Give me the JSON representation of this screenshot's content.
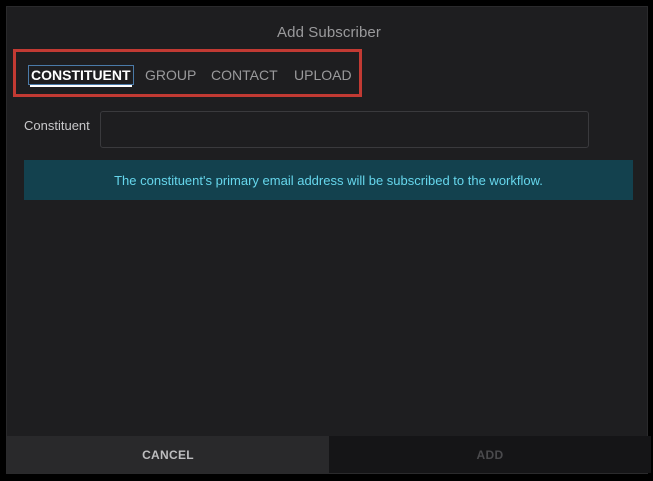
{
  "dialog": {
    "title": "Add Subscriber"
  },
  "tabs": [
    {
      "label": "CONSTITUENT",
      "active": true
    },
    {
      "label": "GROUP",
      "active": false
    },
    {
      "label": "CONTACT",
      "active": false
    },
    {
      "label": "UPLOAD",
      "active": false
    }
  ],
  "form": {
    "constituent_label": "Constituent",
    "constituent_value": "",
    "constituent_placeholder": ""
  },
  "info": {
    "message": "The constituent's primary email address will be subscribed to the workflow."
  },
  "footer": {
    "cancel_label": "CANCEL",
    "add_label": "ADD"
  },
  "colors": {
    "highlight_border": "#c23a33",
    "info_background": "#13414e",
    "info_text": "#66d6ec"
  }
}
